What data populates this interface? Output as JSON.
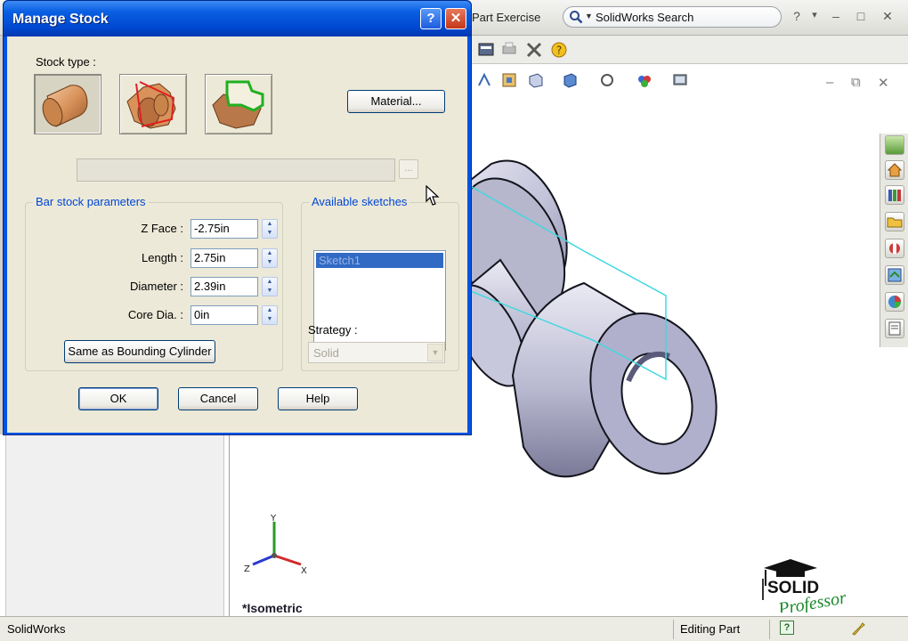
{
  "app": {
    "doc_title": "Part Exercise",
    "search_label": "SolidWorks Search",
    "title_buttons": [
      "?",
      "▾",
      "–",
      "□",
      "✕"
    ],
    "viewport_controls": [
      "–",
      "⧉",
      "✕"
    ]
  },
  "dialog": {
    "title": "Manage Stock",
    "stock_type_label": "Stock type :",
    "stock_types": [
      "bar-stock-icon",
      "revolved-stock-icon",
      "sketch-stock-icon"
    ],
    "material_button": "Material...",
    "browse_button": "...",
    "bar_stock_parameters": {
      "title": "Bar stock parameters",
      "fields": [
        {
          "label": "Z Face :",
          "value": "-2.75in"
        },
        {
          "label": "Length :",
          "value": "2.75in"
        },
        {
          "label": "Diameter :",
          "value": "2.39in"
        },
        {
          "label": "Core Dia. :",
          "value": "0in"
        }
      ],
      "bounding_button": "Same as Bounding Cylinder"
    },
    "available_sketches": {
      "title": "Available sketches",
      "items": [
        "Sketch1"
      ],
      "strategy_label": "Strategy :",
      "strategy_value": "Solid"
    },
    "ok": "OK",
    "cancel": "Cancel",
    "help": "Help"
  },
  "viewport": {
    "view_label": "*Isometric",
    "triad": {
      "y": "Y",
      "z": "Z",
      "x": "X"
    }
  },
  "logo": {
    "line1": "SOLID",
    "line2": "Professor"
  },
  "status": {
    "app_name": "SolidWorks",
    "mode": "Editing Part",
    "help_glyph": "?"
  },
  "colors": {
    "xp_title_blue": "#0054e3",
    "part_face": "#c8c8dc",
    "sketch_line": "#40d8e0"
  }
}
